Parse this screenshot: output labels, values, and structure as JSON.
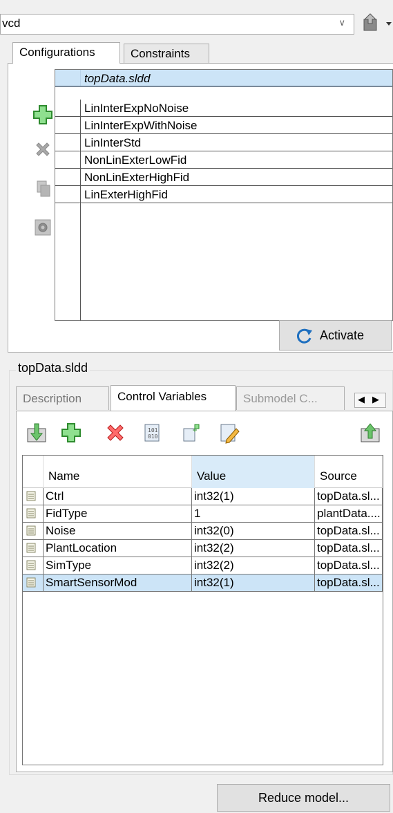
{
  "model_combo": {
    "value": "vcd"
  },
  "top_tabs": [
    {
      "label": "Configurations",
      "active": true
    },
    {
      "label": "Constraints",
      "active": false
    }
  ],
  "config_table": {
    "header": "topData.sldd",
    "rows": [
      "LinInterExpNoNoise",
      "LinInterExpWithNoise",
      "LinInterStd",
      "NonLinExterLowFid",
      "NonLinExterHighFid",
      "LinExterHighFid"
    ]
  },
  "activate_label": "Activate",
  "group_title": "topData.sldd",
  "inner_tabs": [
    {
      "label": "Description",
      "state": "inactive"
    },
    {
      "label": "Control Variables",
      "state": "active"
    },
    {
      "label": "Submodel C...",
      "state": "disabled"
    }
  ],
  "vars_table": {
    "columns": [
      "Name",
      "Value",
      "Source"
    ],
    "rows": [
      {
        "name": "Ctrl",
        "value": "int32(1)",
        "source": "topData.sl..."
      },
      {
        "name": "FidType",
        "value": "1",
        "source": "plantData...."
      },
      {
        "name": "Noise",
        "value": "int32(0)",
        "source": "topData.sl..."
      },
      {
        "name": "PlantLocation",
        "value": "int32(2)",
        "source": "topData.sl..."
      },
      {
        "name": "SimType",
        "value": "int32(2)",
        "source": "topData.sl..."
      },
      {
        "name": "SmartSensorMod",
        "value": "int32(1)",
        "source": "topData.sl...",
        "selected": true
      }
    ]
  },
  "reduce_label": "Reduce model...",
  "colors": {
    "selection": "#cce4f7",
    "add_green": "#3cb043",
    "delete_red": "#e53935"
  }
}
